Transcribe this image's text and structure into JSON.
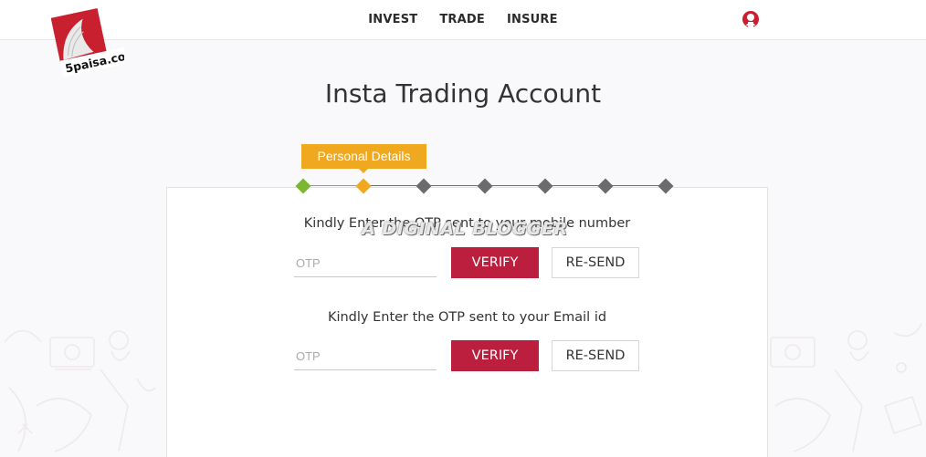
{
  "brand": {
    "logo_text": "5paisa.com",
    "accent": "#bb1f3d"
  },
  "nav": {
    "items": [
      "INVEST",
      "TRADE",
      "INSURE"
    ]
  },
  "user_icon": "user-icon",
  "page": {
    "title": "Insta Trading Account"
  },
  "stepper": {
    "active_step_label": "Personal Details",
    "total_steps": 7,
    "completed_steps": 1,
    "current_step": 2,
    "colors": {
      "done": "#7cb82f",
      "active": "#f0a91f",
      "pending": "#6b6b6b"
    }
  },
  "mobile_otp": {
    "label": "Kindly Enter the OTP sent to your mobile number",
    "placeholder": "OTP",
    "value": "",
    "verify_label": "VERIFY",
    "resend_label": "RE-SEND"
  },
  "email_otp": {
    "label": "Kindly Enter the OTP sent to your Email id",
    "placeholder": "OTP",
    "value": "",
    "verify_label": "VERIFY",
    "resend_label": "RE-SEND"
  },
  "watermark": "A DIGINAL BLOGGER"
}
